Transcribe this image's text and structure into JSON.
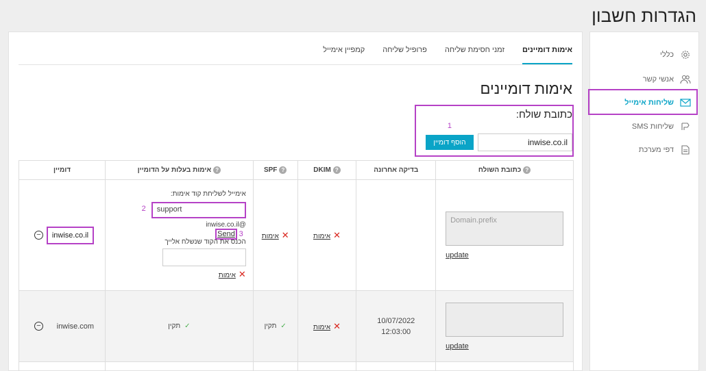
{
  "page": {
    "title": "הגדרות חשבון"
  },
  "sidebar": {
    "items": [
      {
        "label": "כללי",
        "icon": "gear-icon"
      },
      {
        "label": "אנשי קשר",
        "icon": "contacts-icon"
      },
      {
        "label": "שליחות אימייל",
        "icon": "mail-icon",
        "active": true
      },
      {
        "label": "שליחות SMS",
        "icon": "sms-icon"
      },
      {
        "label": "דפי מערכת",
        "icon": "pages-icon"
      }
    ]
  },
  "tabs": [
    "אימות דומיינים",
    "זמני חסימת שליחה",
    "פרופיל שליחה",
    "קמפיין אימייל"
  ],
  "section": {
    "title": "אימות דומיינים",
    "sender_label": "כתובת שולח:"
  },
  "add_form": {
    "domain_value": "inwise.co.il",
    "add_button": "הוסף דומיין"
  },
  "annotations": {
    "n1": "1",
    "n2": "2",
    "n3": "3"
  },
  "table": {
    "headers": {
      "domain": "דומיין",
      "ownership": "אימות בעלות על הדומיין",
      "spf": "SPF",
      "dkim": "DKIM",
      "last_check": "בדיקה אחרונה",
      "sender": "כתובת השולח"
    },
    "rows": [
      {
        "domain": "inwise.co.il",
        "ownership": {
          "email_label": "אימייל לשליחת קוד אימות:",
          "email_value": "support",
          "email_suffix": "@inwise.co.il",
          "send": "Send",
          "code_label": "הכנס את הקוד שנשלח אלייך",
          "verify": "אימות"
        },
        "spf": "אימות",
        "dkim": "אימות",
        "last_check": "",
        "sender_placeholder": "Domain.prefix",
        "update": "update"
      },
      {
        "domain": "inwise.com",
        "ownership": "תקין",
        "spf": "תקין",
        "dkim": "אימות",
        "last_check_date": "10/07/2022",
        "last_check_time": "12:03:00",
        "sender_placeholder": "",
        "update": "update"
      }
    ]
  }
}
